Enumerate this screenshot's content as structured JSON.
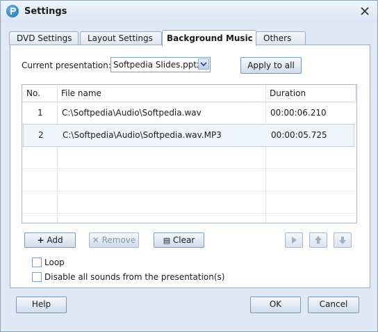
{
  "window": {
    "title": "Settings"
  },
  "tabs": [
    {
      "label": "DVD Settings"
    },
    {
      "label": "Layout Settings"
    },
    {
      "label": "Background Music"
    },
    {
      "label": "Others"
    }
  ],
  "active_tab": "Background Music",
  "current_presentation": {
    "label": "Current presentation:",
    "selected": "Softpedia Slides.pptx",
    "apply_label": "Apply to all"
  },
  "table": {
    "columns": [
      "No.",
      "File name",
      "Duration"
    ],
    "rows": [
      {
        "no": "1",
        "file": "C:\\Softpedia\\Audio\\Softpedia.wav",
        "duration": "00:00:06.210"
      },
      {
        "no": "2",
        "file": "C:\\Softpedia\\Audio\\Softpedia.wav.MP3",
        "duration": "00:00:05.725"
      }
    ]
  },
  "actions": {
    "add": "Add",
    "remove": "Remove",
    "clear": "Clear"
  },
  "options": {
    "loop": "Loop",
    "disable_sounds": "Disable all sounds from the presentation(s)"
  },
  "footer": {
    "help": "Help",
    "ok": "OK",
    "cancel": "Cancel"
  },
  "icons": [
    "app-icon",
    "close-icon",
    "dropdown-arrow-icon",
    "plus-icon",
    "remove-x-icon",
    "clear-icon",
    "play-icon",
    "move-up-icon",
    "move-down-icon"
  ]
}
